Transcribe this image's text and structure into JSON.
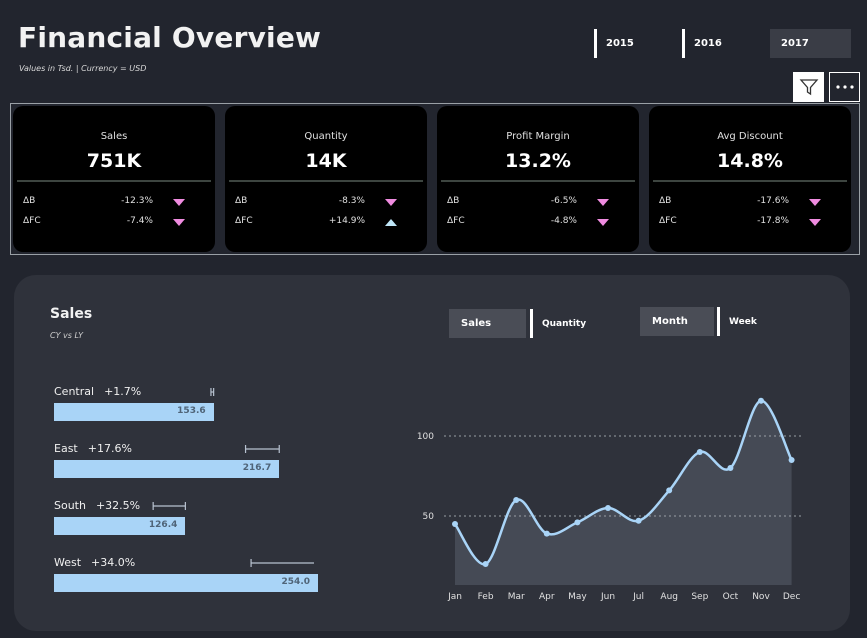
{
  "header": {
    "title": "Financial Overview",
    "subtitle": "Values in Tsd.  |  Currency = USD"
  },
  "years": [
    {
      "label": "2015",
      "selected": false
    },
    {
      "label": "2016",
      "selected": false
    },
    {
      "label": "2017",
      "selected": true
    }
  ],
  "toolbar": {
    "filter_icon": "filter-icon",
    "more_icon": "more-options-icon"
  },
  "kpis": [
    {
      "name": "Sales",
      "value": "751K",
      "rows": [
        {
          "label": "ΔB",
          "value": "-12.3%",
          "direction": "down"
        },
        {
          "label": "ΔFC",
          "value": "-7.4%",
          "direction": "down"
        }
      ]
    },
    {
      "name": "Quantity",
      "value": "14K",
      "rows": [
        {
          "label": "ΔB",
          "value": "-8.3%",
          "direction": "down"
        },
        {
          "label": "ΔFC",
          "value": "+14.9%",
          "direction": "up"
        }
      ]
    },
    {
      "name": "Profit Margin",
      "value": "13.2%",
      "rows": [
        {
          "label": "ΔB",
          "value": "-6.5%",
          "direction": "down"
        },
        {
          "label": "ΔFC",
          "value": "-4.8%",
          "direction": "down"
        }
      ]
    },
    {
      "name": "Avg Discount",
      "value": "14.8%",
      "rows": [
        {
          "label": "ΔB",
          "value": "-17.6%",
          "direction": "down"
        },
        {
          "label": "ΔFC",
          "value": "-17.8%",
          "direction": "down"
        }
      ]
    }
  ],
  "colors": {
    "down": "#f08ce0",
    "up": "#bfe6f7",
    "bar": "#a9d4f7",
    "line": "#a9d4f7",
    "area": "#454a55"
  },
  "sales_panel": {
    "title": "Sales",
    "subtitle": "CY vs LY",
    "measure_toggle": [
      {
        "label": "Sales",
        "selected": true
      },
      {
        "label": "Quantity",
        "selected": false
      }
    ],
    "period_toggle": [
      {
        "label": "Month",
        "selected": true
      },
      {
        "label": "Week",
        "selected": false
      }
    ]
  },
  "chart_data": [
    {
      "type": "bar",
      "categories": [
        "Central",
        "East",
        "South",
        "West"
      ],
      "deltas": [
        "+1.7%",
        "+17.6%",
        "+32.5%",
        "+34.0%"
      ],
      "values": [
        153.6,
        216.7,
        126.4,
        254.0
      ],
      "value_labels": [
        "153.6",
        "216.7",
        "126.4",
        "254.0"
      ],
      "prior_year_values": [
        151.0,
        184.3,
        95.4,
        189.6
      ]
    },
    {
      "type": "area",
      "categories": [
        "Jan",
        "Feb",
        "Mar",
        "Apr",
        "May",
        "Jun",
        "Jul",
        "Aug",
        "Sep",
        "Oct",
        "Nov",
        "Dec"
      ],
      "values": [
        45,
        20,
        60,
        39,
        46,
        55,
        47,
        66,
        90,
        80,
        122,
        85
      ],
      "y_ticks": [
        "100",
        "50"
      ],
      "grid": true
    }
  ]
}
